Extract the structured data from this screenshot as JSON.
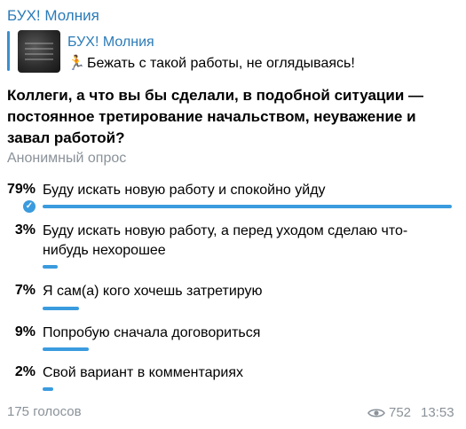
{
  "message": {
    "channel_name": "БУХ! Молния",
    "reply": {
      "title": "БУХ! Молния",
      "emoji": "🏃",
      "text": "Бежать с такой работы, не оглядываясь!"
    }
  },
  "poll": {
    "question": "Коллеги, а что вы бы сделали, в подобной ситуации — постоянное третирование начальством, неуважение и завал работой?",
    "type_label": "Анонимный опрос",
    "options": [
      {
        "percent": "79%",
        "text": "Буду искать новую работу и спокойно уйду",
        "share": 0.79,
        "selected": true
      },
      {
        "percent": "3%",
        "text": "Буду искать новую работу, а перед уходом сделаю что-нибудь нехорошее",
        "share": 0.03,
        "selected": false
      },
      {
        "percent": "7%",
        "text": "Я сам(а) кого хочешь затретирую",
        "share": 0.07,
        "selected": false
      },
      {
        "percent": "9%",
        "text": "Попробую сначала договориться",
        "share": 0.09,
        "selected": false
      },
      {
        "percent": "2%",
        "text": "Свой вариант в комментариях",
        "share": 0.02,
        "selected": false
      }
    ],
    "votes_label": "175 голосов"
  },
  "footer": {
    "views": "752",
    "time": "13:53"
  },
  "colors": {
    "accent": "#3a9bde",
    "link": "#2b7bb8",
    "muted": "#8a9299"
  },
  "icons": {
    "views": "eye-icon",
    "selected": "checkmark-icon",
    "thumbnail": "channel-thumbnail"
  }
}
